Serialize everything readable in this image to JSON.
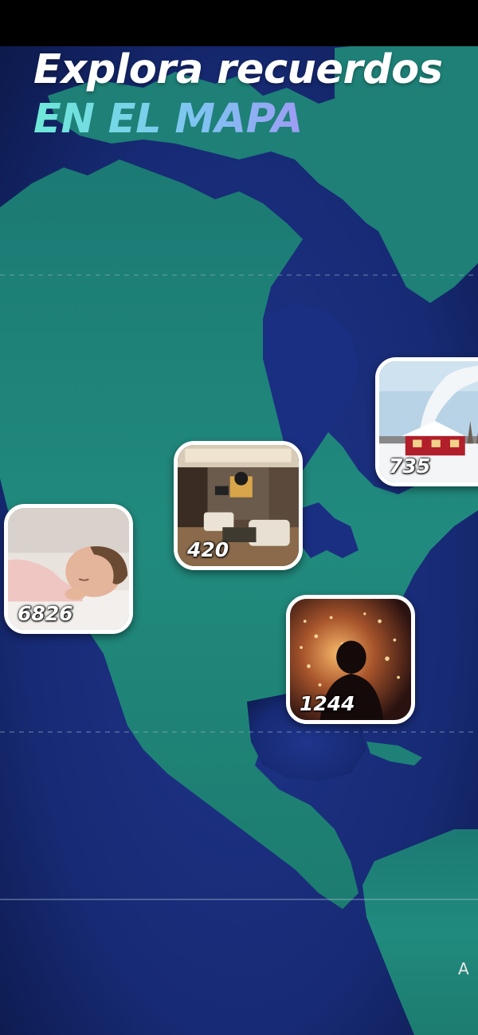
{
  "headline": {
    "line1": "Explora recuerdos",
    "line2": "EN EL MAPA"
  },
  "map": {
    "ocean_color": "#1a2c7a",
    "land_color": "#1f7f78",
    "edge_label": "A"
  },
  "pins": [
    {
      "id": "snow-house",
      "count": "735",
      "icon": "snowy-house-photo"
    },
    {
      "id": "living-room",
      "count": "420",
      "icon": "living-room-photo"
    },
    {
      "id": "baby",
      "count": "6826",
      "icon": "sleeping-baby-photo"
    },
    {
      "id": "fireworks",
      "count": "1244",
      "icon": "child-fireworks-photo"
    }
  ]
}
